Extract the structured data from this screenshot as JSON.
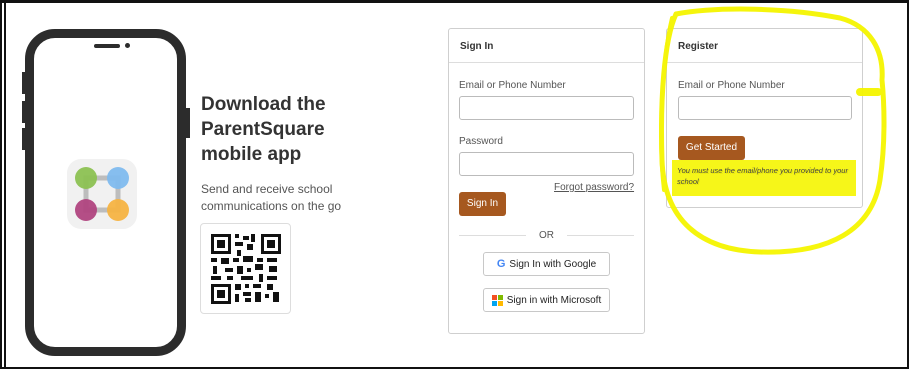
{
  "download": {
    "title": "Download the ParentSquare mobile app",
    "subtitle": "Send and receive school communications on the go"
  },
  "signin": {
    "heading": "Sign In",
    "email_label": "Email or Phone Number",
    "email_value": "",
    "password_label": "Password",
    "password_value": "",
    "forgot_link": "Forgot password?",
    "submit_label": "Sign In",
    "or_label": "OR",
    "google_label": "Sign In with Google",
    "microsoft_label": "Sign in with Microsoft"
  },
  "register": {
    "heading": "Register",
    "email_label": "Email or Phone Number",
    "email_value": "",
    "submit_label": "Get Started",
    "hint": "You must use the email/phone you provided to your school"
  },
  "colors": {
    "accent_brown": "#a6581f",
    "highlight_yellow": "#f5f500",
    "app_green": "#8cc152",
    "app_blue": "#7fbbee",
    "app_magenta": "#b0457f",
    "app_orange": "#f5b342"
  }
}
